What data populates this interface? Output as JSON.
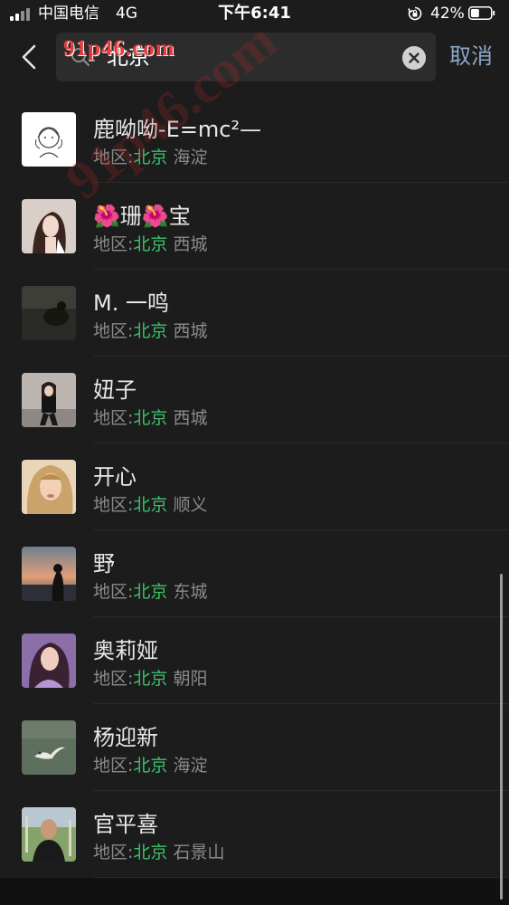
{
  "status_bar": {
    "carrier": "中国电信",
    "network": "4G",
    "time": "下午6:41",
    "battery": "42%",
    "battery_level": 0.42
  },
  "search": {
    "query": "北京",
    "cancel_label": "取消"
  },
  "watermark": "91p46.com",
  "diagonal_watermark": "91p46.com",
  "results": {
    "region_prefix": "地区:",
    "items": [
      {
        "name": "鹿呦呦-E=mc²—",
        "city": "北京",
        "district": "海淀",
        "avatar": "line-art-girl"
      },
      {
        "name": "🌺珊🌺宝",
        "city": "北京",
        "district": "西城",
        "avatar": "portrait-woman"
      },
      {
        "name": "M.  一鸣",
        "city": "北京",
        "district": "西城",
        "avatar": "dark-photo"
      },
      {
        "name": "妞子",
        "city": "北京",
        "district": "西城",
        "avatar": "woman-sitting"
      },
      {
        "name": "开心",
        "city": "北京",
        "district": "顺义",
        "avatar": "blonde-woman"
      },
      {
        "name": "野",
        "city": "北京",
        "district": "东城",
        "avatar": "sunset-silhouette"
      },
      {
        "name": "奥莉娅",
        "city": "北京",
        "district": "朝阳",
        "avatar": "woman-purple"
      },
      {
        "name": "杨迎新",
        "city": "北京",
        "district": "海淀",
        "avatar": "seagull"
      },
      {
        "name": "官平喜",
        "city": "北京",
        "district": "石景山",
        "avatar": "man-park"
      }
    ]
  },
  "colors": {
    "background": "#1c1c1c",
    "accent_green": "#3cc06a",
    "cancel_blue": "#8aa6c8",
    "watermark_red": "#e43d3d"
  }
}
